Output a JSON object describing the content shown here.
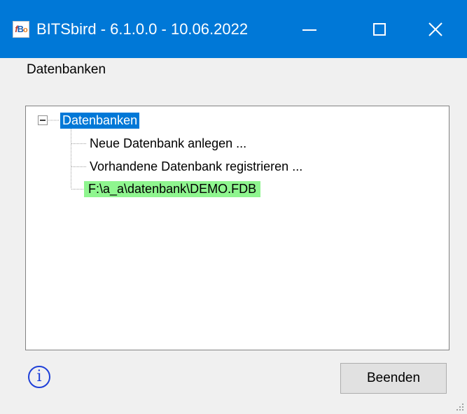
{
  "window": {
    "title": "BITSbird - 6.1.0.0 - 10.06.2022",
    "app_icon": "bitsbird-icon",
    "controls": [
      "minimize-icon",
      "maximize-icon",
      "close-icon"
    ]
  },
  "menu": {
    "items": [
      {
        "label": "Datenbanken"
      }
    ]
  },
  "tree": {
    "root": {
      "label": "Datenbanken",
      "expanded": true,
      "selected": true
    },
    "children": [
      {
        "label": "Neue Datenbank anlegen ..."
      },
      {
        "label": "Vorhandene Datenbank registrieren ..."
      },
      {
        "label": "F:\\a_a\\datenbank\\DEMO.FDB",
        "highlight_color": "#8ff58f"
      }
    ]
  },
  "footer": {
    "info_icon": "info-icon",
    "close_button_label": "Beenden"
  },
  "colors": {
    "titlebar": "#0078d7",
    "selection": "#0078d7",
    "highlight": "#8ff58f",
    "info": "#1e3fd8"
  }
}
